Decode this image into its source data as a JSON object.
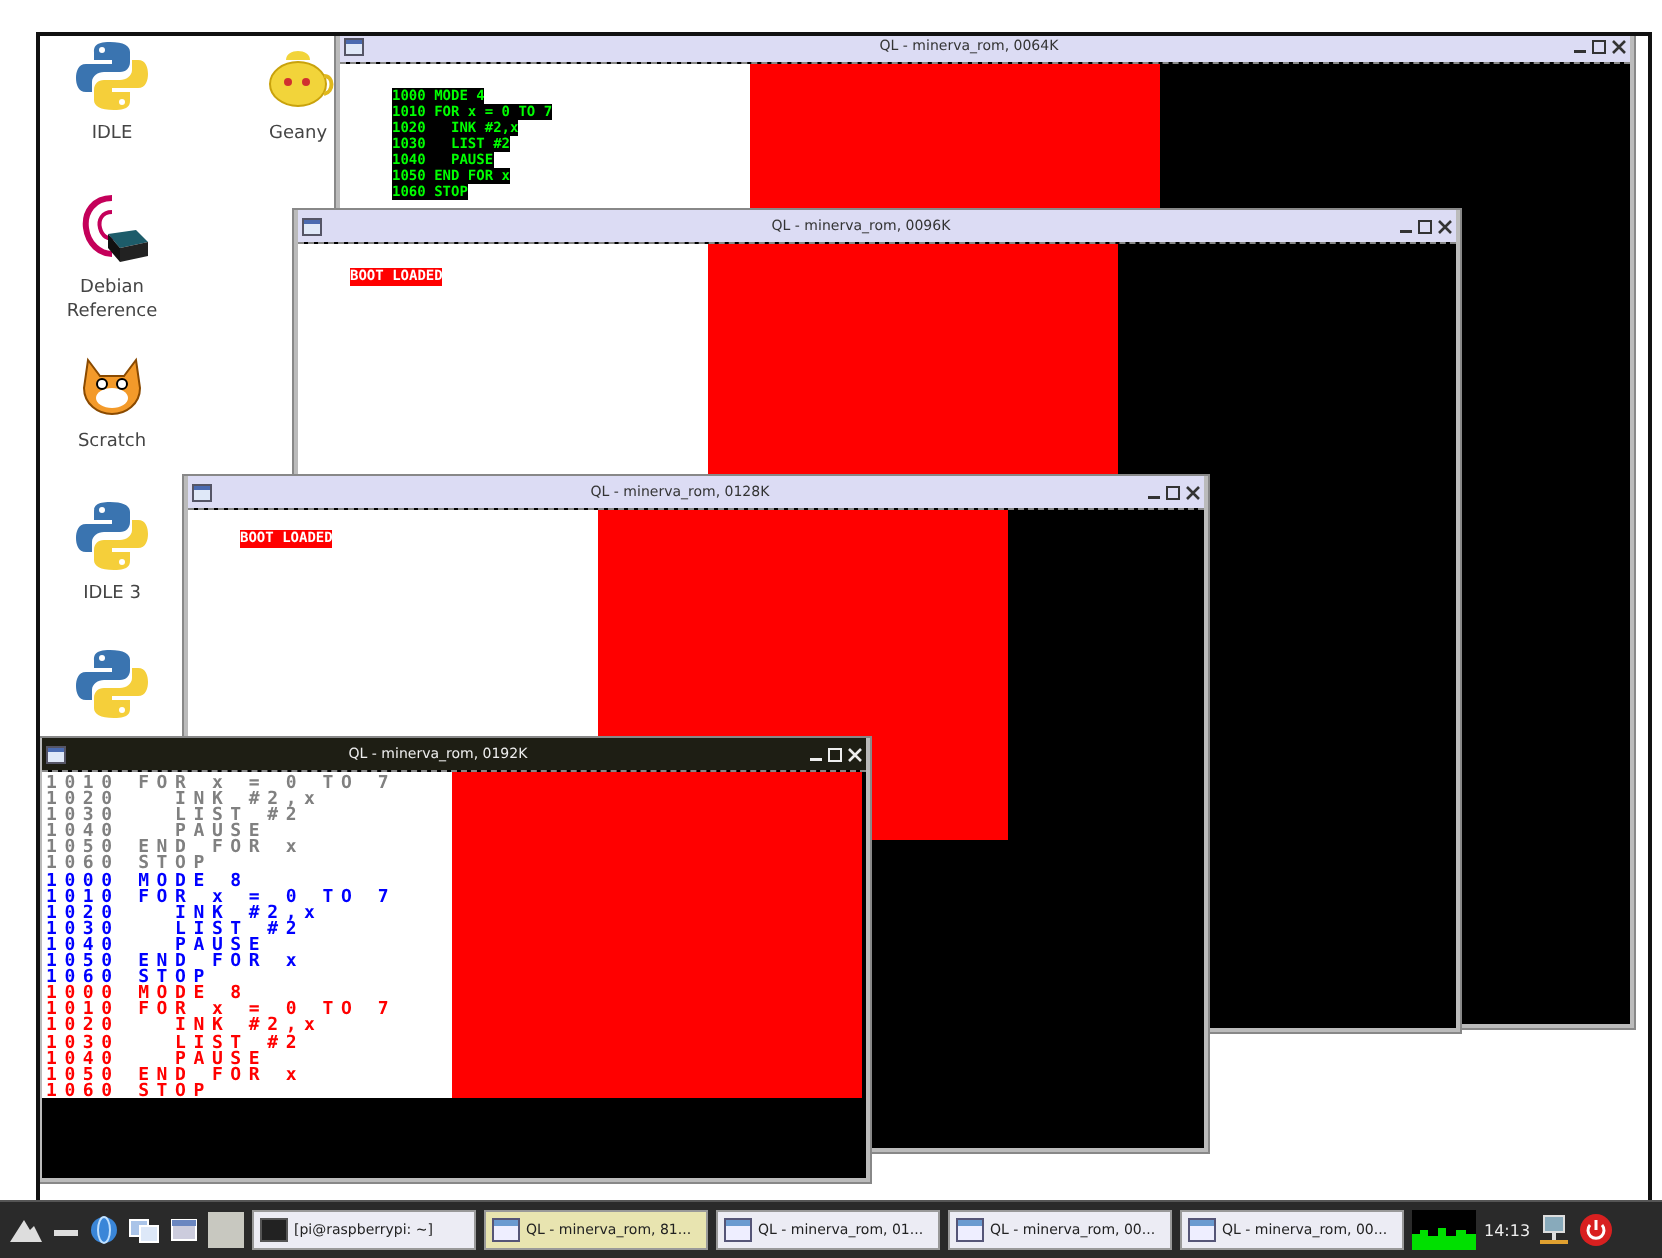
{
  "desktop_icons": [
    {
      "label": "IDLE",
      "kind": "python"
    },
    {
      "label": "Geany",
      "kind": "teapot"
    },
    {
      "label": "Debian\nReference",
      "kind": "debian"
    },
    {
      "label": "Scratch",
      "kind": "cat"
    },
    {
      "label": "IDLE 3",
      "kind": "python"
    },
    {
      "kind": "python"
    }
  ],
  "windows": [
    {
      "title": "QL - minerva_rom, 0064K",
      "active": false,
      "listing": [
        {
          "text": "1000 MODE 4",
          "kind": "terminal"
        },
        {
          "text": "1010 FOR x = 0 TO 7",
          "kind": "terminal"
        },
        {
          "text": "1020   INK #2,x",
          "kind": "terminal"
        },
        {
          "text": "1030   LIST #2",
          "kind": "terminal"
        },
        {
          "text": "1040   PAUSE",
          "kind": "terminal"
        },
        {
          "text": "1050 END FOR x",
          "kind": "terminal"
        },
        {
          "text": "1060 STOP",
          "kind": "terminal"
        }
      ]
    },
    {
      "title": "QL - minerva_rom, 0096K",
      "active": false,
      "listing": [
        {
          "text": "BOOT LOADED",
          "kind": "banner"
        }
      ]
    },
    {
      "title": "QL - minerva_rom, 0128K",
      "active": false,
      "listing": [
        {
          "text": "BOOT LOADED",
          "kind": "banner"
        }
      ]
    },
    {
      "title": "QL - minerva_rom, 0192K",
      "active": true,
      "listing": [
        {
          "text": "1010 FOR x = 0 TO 7",
          "kind": "plain",
          "color": "#808080"
        },
        {
          "text": "1020   INK #2,x",
          "kind": "plain",
          "color": "#808080"
        },
        {
          "text": "1030   LIST #2",
          "kind": "plain",
          "color": "#808080"
        },
        {
          "text": "1040   PAUSE",
          "kind": "plain",
          "color": "#808080"
        },
        {
          "text": "1050 END FOR x",
          "kind": "plain",
          "color": "#808080"
        },
        {
          "text": "1060 STOP",
          "kind": "plain",
          "color": "#808080"
        },
        {
          "text": "1000 MODE 8",
          "kind": "plain",
          "color": "#0000ff"
        },
        {
          "text": "1010 FOR x = 0 TO 7",
          "kind": "plain",
          "color": "#0000ff"
        },
        {
          "text": "1020   INK #2,x",
          "kind": "plain",
          "color": "#0000ff"
        },
        {
          "text": "1030   LIST #2",
          "kind": "plain",
          "color": "#0000ff"
        },
        {
          "text": "1040   PAUSE",
          "kind": "plain",
          "color": "#0000ff"
        },
        {
          "text": "1050 END FOR x",
          "kind": "plain",
          "color": "#0000ff"
        },
        {
          "text": "1060 STOP",
          "kind": "plain",
          "color": "#0000ff"
        },
        {
          "text": "1000 MODE 8",
          "kind": "plain",
          "color": "#ff0000"
        },
        {
          "text": "1010 FOR x = 0 TO 7",
          "kind": "plain",
          "color": "#ff0000"
        },
        {
          "text": "1020   INK #2,x",
          "kind": "plain",
          "color": "#ff0000"
        },
        {
          "text": "1030   LIST #2",
          "kind": "plain",
          "color": "#ff0000"
        },
        {
          "text": "1040   PAUSE",
          "kind": "plain",
          "color": "#ff0000"
        },
        {
          "text": "1050 END FOR x",
          "kind": "plain",
          "color": "#ff0000"
        },
        {
          "text": "1060 STOP",
          "kind": "plain",
          "color": "#ff0000"
        }
      ]
    }
  ],
  "taskbar": {
    "tasks": [
      {
        "label": "[pi@raspberrypi: ~]",
        "kind": "terminal",
        "selected": false
      },
      {
        "label": "QL - minerva_rom, 81...",
        "kind": "window",
        "selected": true
      },
      {
        "label": "QL - minerva_rom, 01...",
        "kind": "window",
        "selected": false
      },
      {
        "label": "QL - minerva_rom, 00...",
        "kind": "window",
        "selected": false
      },
      {
        "label": "QL - minerva_rom, 00...",
        "kind": "window",
        "selected": false
      }
    ],
    "clock": "14:13"
  }
}
